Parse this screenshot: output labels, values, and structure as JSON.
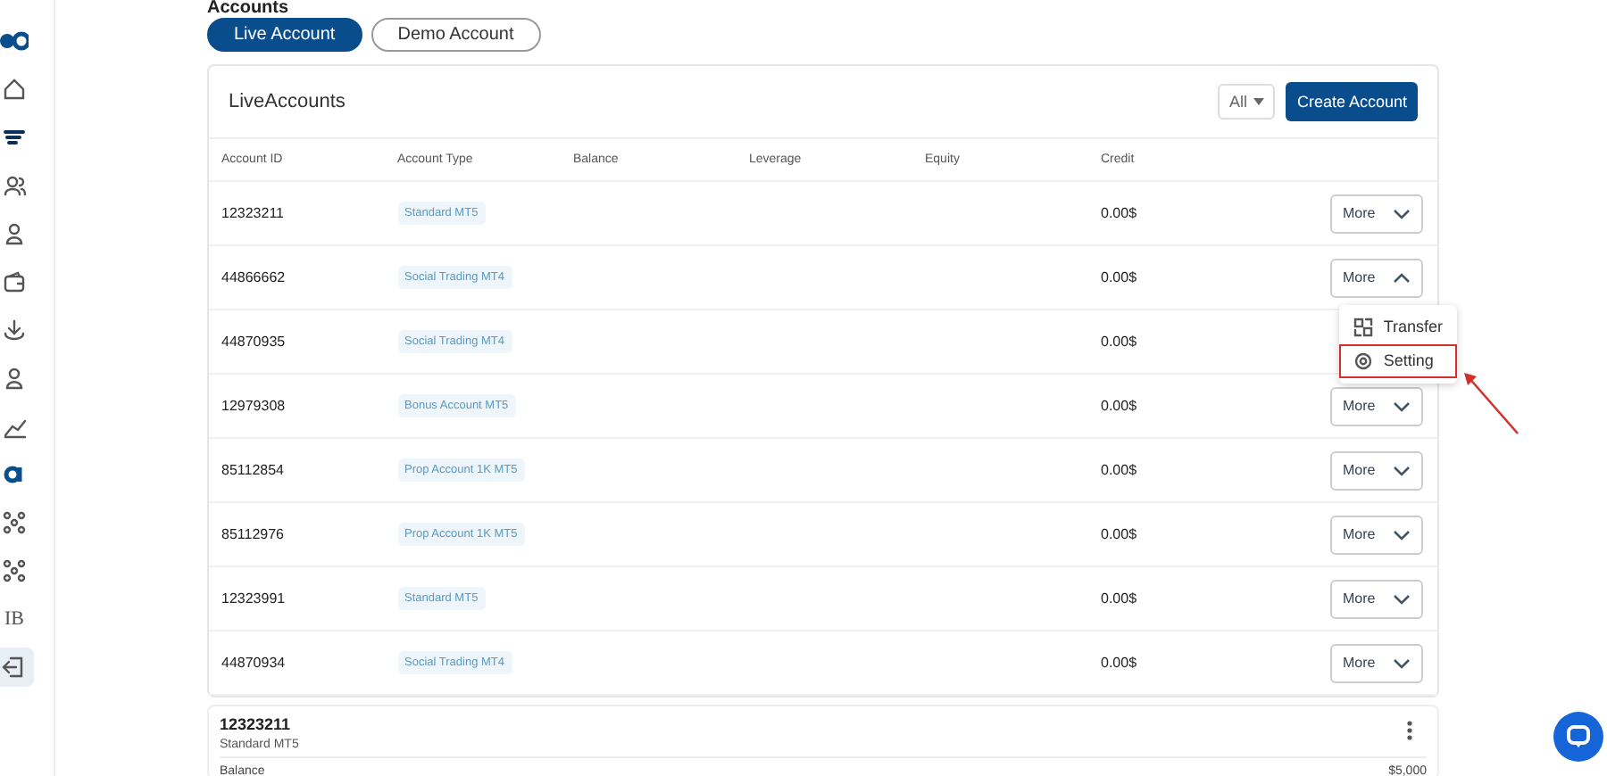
{
  "sidebar": {
    "items": [
      {
        "kind": "logo",
        "selected": false
      },
      {
        "kind": "home",
        "selected": false
      },
      {
        "kind": "lines",
        "selected": false
      },
      {
        "kind": "users",
        "selected": false
      },
      {
        "kind": "user",
        "selected": false
      },
      {
        "kind": "wallet",
        "selected": false
      },
      {
        "kind": "download",
        "selected": false
      },
      {
        "kind": "user",
        "selected": false
      },
      {
        "kind": "chart",
        "selected": false
      },
      {
        "kind": "mark",
        "selected": false
      },
      {
        "kind": "network",
        "selected": false
      },
      {
        "kind": "network",
        "selected": false
      },
      {
        "kind": "text",
        "label": "IB",
        "selected": false
      },
      {
        "kind": "logout",
        "selected": true
      }
    ]
  },
  "page_title": "Accounts",
  "tabs": [
    {
      "label": "Live Account",
      "selected": true
    },
    {
      "label": "Demo Account",
      "selected": false
    }
  ],
  "card": {
    "title": "LiveAccounts",
    "filter": "All",
    "create_button": "Create Account"
  },
  "table": {
    "columns": [
      "Account ID",
      "Account Type",
      "Balance",
      "Leverage",
      "Equity",
      "Credit"
    ],
    "rows": [
      {
        "id": "12323211",
        "type": "Standard MT5",
        "credit": "0.00$",
        "action": "More",
        "expanded": false
      },
      {
        "id": "44866662",
        "type": "Social Trading MT4",
        "credit": "0.00$",
        "action": "More",
        "expanded": true
      },
      {
        "id": "44870935",
        "type": "Social Trading MT4",
        "credit": "0.00$"
      },
      {
        "id": "12979308",
        "type": "Bonus Account MT5",
        "credit": "0.00$",
        "action": "More",
        "expanded": false
      },
      {
        "id": "85112854",
        "type": "Prop Account 1K MT5",
        "credit": "0.00$",
        "action": "More",
        "expanded": false
      },
      {
        "id": "85112976",
        "type": "Prop Account 1K MT5",
        "credit": "0.00$",
        "action": "More",
        "expanded": false
      },
      {
        "id": "12323991",
        "type": "Standard MT5",
        "credit": "0.00$",
        "action": "More",
        "expanded": false
      },
      {
        "id": "44870934",
        "type": "Social Trading MT4",
        "credit": "0.00$",
        "action": "More",
        "expanded": false
      }
    ]
  },
  "dropdown": {
    "items": [
      {
        "kind": "transfer",
        "label": "Transfer",
        "highlighted": false
      },
      {
        "kind": "setting",
        "label": "Setting",
        "highlighted": true
      }
    ]
  },
  "detail_card": {
    "id": "12323211",
    "type": "Standard MT5",
    "fields": [
      {
        "label": "Balance",
        "value": "$5,000"
      }
    ]
  }
}
